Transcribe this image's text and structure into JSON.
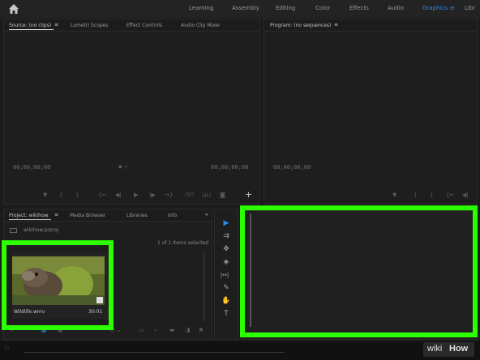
{
  "header": {
    "workspaces": [
      "Learning",
      "Assembly",
      "Editing",
      "Color",
      "Effects",
      "Audio",
      "Graphics",
      "Libr"
    ],
    "active": "Graphics"
  },
  "source_panel": {
    "tabs": [
      "Source: (no clips)",
      "Lumetri Scopes",
      "Effect Controls",
      "Audio Clip Mixer"
    ],
    "tc_left": "00;00;00;00",
    "tc_right": "00;00;00;00"
  },
  "program_panel": {
    "tab": "Program: (no sequences)",
    "tc_left": "00;00;00;00"
  },
  "project_panel": {
    "tabs": [
      "Project: wikihow",
      "Media Browser",
      "Libraries",
      "Info"
    ],
    "file": "wikihow.prproj",
    "selection": "1 of 1 items selected",
    "clip_name": "Wildlife.wmv",
    "clip_duration": "30:01"
  },
  "tools": [
    "selection-tool",
    "track-select-tool",
    "ripple-edit-tool",
    "razor-tool",
    "slip-tool",
    "pen-tool",
    "hand-tool",
    "type-tool"
  ],
  "tool_glyphs": [
    "▶",
    "⇉",
    "✥",
    "◈",
    "|↔|",
    "✎",
    "✋",
    "T"
  ],
  "watermark": {
    "wiki": "wiki",
    "how": "How"
  },
  "colors": {
    "highlight": "#2bff00",
    "accent": "#2d8ceb",
    "bg": "#1b1b1b"
  }
}
